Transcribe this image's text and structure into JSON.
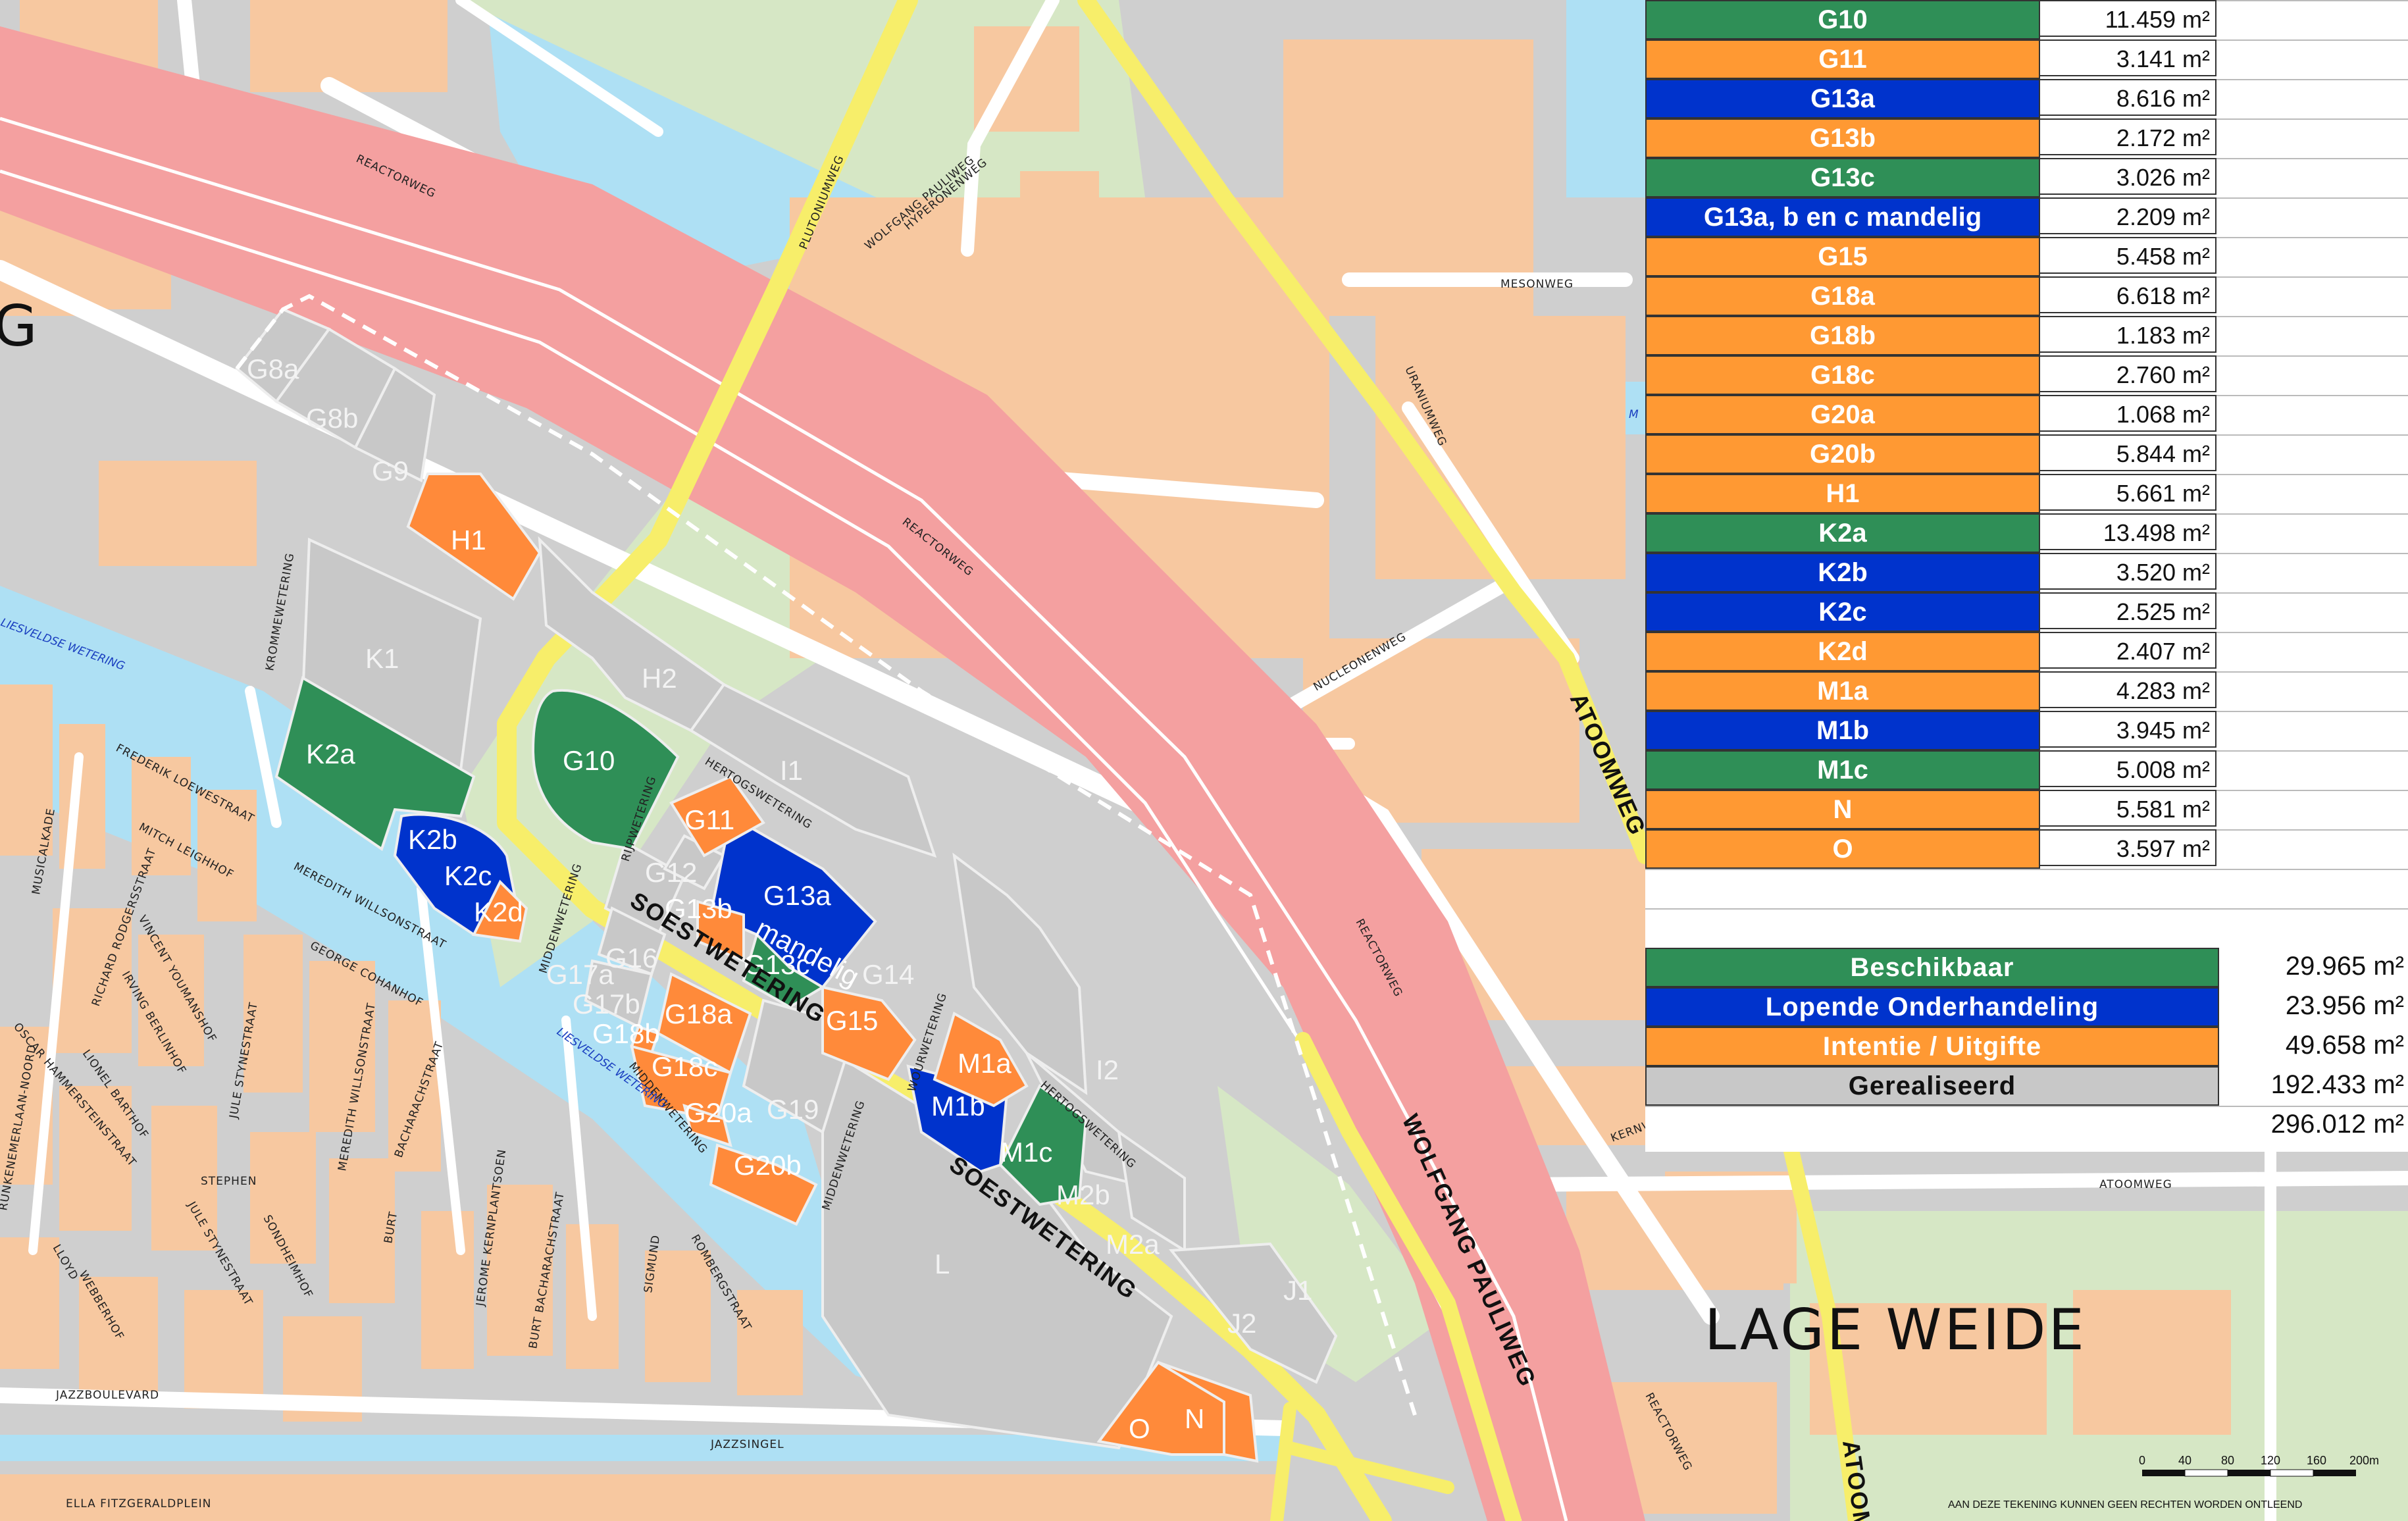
{
  "colors": {
    "beschikbaar": "#2f8f57",
    "onderhandeling": "#0033cc",
    "intentie": "#ff9933",
    "gerealiseerd": "#c8c8c8",
    "road": "#ffffff",
    "highway": "#f4a0a0",
    "main_road": "#f7ee6a",
    "building": "#f7c8a0",
    "water": "#aee0f4",
    "green": "#d6e7c5"
  },
  "map": {
    "area_label": "LAGE WEIDE",
    "partial_label": "G",
    "streets": {
      "reactorweg_1": "REACTORWEG",
      "reactorweg_2": "REACTORWEG",
      "reactorweg_3": "REACTORWEG",
      "reactorweg_4": "REACTORWEG",
      "plutoniumweg": "PLUTONIUMWEG",
      "wolfgang_pauliweg_1": "WOLFGANG PAULIWEG",
      "wolfgang_pauliweg_2": "WOLFGANG PAULIWEG",
      "hyperonenweg": "HYPERONENWEG",
      "mesonweg": "MESONWEG",
      "uraniumweg": "URANIUMWEG",
      "nucleonenweg": "NUCLEONENWEG",
      "atoomweg_1": "ATOOMWEG",
      "atoomweg_2": "ATOOMWEG",
      "atoomweg_3": "ATOOMWEG",
      "soestwetering_1": "SOESTWETERING",
      "soestwetering_2": "SOESTWETERING",
      "hertogswetering_1": "HERTOGSWETERING",
      "hertogswetering_2": "HERTOGSWETERING",
      "rijpwetering": "RIJPWETERING",
      "middenwetering_1": "MIDDENWETERING",
      "middenwetering_2": "MIDDENWETERING",
      "middenwetering_3": "MIDDENWETERING",
      "wourwetering": "WOURWETERING",
      "krommewetering": "KROMMEWETERING",
      "frederik_loewestraat": "FREDERIK LOEWESTRAAT",
      "mitch_leighhof": "MITCH LEIGHHOF",
      "musicalkade": "MUSICALKADE",
      "meredith_willsonstraat_1": "MEREDITH WILLSONSTRAAT",
      "meredith_willsonstraat_2": "MEREDITH WILLSONSTRAAT",
      "george_cohanhof": "GEORGE COHANHOF",
      "jule_stynestraat_1": "JULE STYNESTRAAT",
      "jule_stynestraat_2": "JULE STYNESTRAAT",
      "lionel_barthof": "LIONEL BARTHOF",
      "oscar_hammersteinstraat": "OSCAR HAMMERSTEINSTRAAT",
      "richard_rodgersstraat": "RICHARD RODGERSSTRAAT",
      "vincent_youmanshof": "VINCENT YOUMANSHOF",
      "irving_berlinhof": "IRVING BERLINHOF",
      "bacharachstraat": "BACHARACHSTRAAT",
      "burt_bacharachstraat": "BURT BACHARACHSTRAAT",
      "jerome_kernplantsoen": "JEROME KERNPLANTSOEN",
      "rombergstraat": "ROMBERGSTRAAT",
      "sigmund": "SIGMUND",
      "stephen": "STEPHEN",
      "sondheimhof": "SONDHEIMHOF",
      "lloyd": "LLOYD",
      "webberhof": "WEBBERHOF",
      "jazzboulevard": "JAZZBOULEVARD",
      "jazzsingel": "JAZZSINGEL",
      "ella_fitzgeraldplein": "ELLA FITZGERALDPLEIN",
      "runkenemerlaan_noord": "RUNKENEMERLAAN-NOORD",
      "kernweg": "KERNW",
      "burt": "BURT"
    },
    "water_labels": {
      "liesveldse_1": "LIESVELDSE WETERING",
      "liesveldse_2": "LIESVELDSE WETERING",
      "m": "M"
    }
  },
  "plots": {
    "G8a": "G8a",
    "G8b": "G8b",
    "G9": "G9",
    "H1": "H1",
    "H2": "H2",
    "K1": "K1",
    "K2a": "K2a",
    "K2b": "K2b",
    "K2c": "K2c",
    "K2d": "K2d",
    "G10": "G10",
    "I1": "I1",
    "G11": "G11",
    "G12": "G12",
    "G13a": "G13a",
    "mandelig": "mandelig",
    "G13b": "G13b",
    "G13c": "G13c",
    "G14": "G14",
    "G15": "G15",
    "G16": "G16",
    "G17a": "G17a",
    "G17b": "G17b",
    "G18a": "G18a",
    "G18b": "G18b",
    "G18c": "G18c",
    "G19": "G19",
    "G20a": "G20a",
    "G20b": "G20b",
    "M1a": "M1a",
    "M1b": "M1b",
    "M1c": "M1c",
    "I2": "I2",
    "M2a": "M2a",
    "M2b": "M2b",
    "L": "L",
    "J1": "J1",
    "J2": "J2",
    "O": "O",
    "N": "N"
  },
  "table": {
    "rows": [
      {
        "name": "G10",
        "area": "11.459 m²",
        "status": "beschikbaar"
      },
      {
        "name": "G11",
        "area": "3.141 m²",
        "status": "intentie"
      },
      {
        "name": "G13a",
        "area": "8.616 m²",
        "status": "onderhandeling"
      },
      {
        "name": "G13b",
        "area": "2.172 m²",
        "status": "intentie"
      },
      {
        "name": "G13c",
        "area": "3.026 m²",
        "status": "beschikbaar"
      },
      {
        "name": "G13a, b en c mandelig",
        "area": "2.209 m²",
        "status": "onderhandeling"
      },
      {
        "name": "G15",
        "area": "5.458 m²",
        "status": "intentie"
      },
      {
        "name": "G18a",
        "area": "6.618 m²",
        "status": "intentie"
      },
      {
        "name": "G18b",
        "area": "1.183 m²",
        "status": "intentie"
      },
      {
        "name": "G18c",
        "area": "2.760 m²",
        "status": "intentie"
      },
      {
        "name": "G20a",
        "area": "1.068 m²",
        "status": "intentie"
      },
      {
        "name": "G20b",
        "area": "5.844 m²",
        "status": "intentie"
      },
      {
        "name": "H1",
        "area": "5.661 m²",
        "status": "intentie"
      },
      {
        "name": "K2a",
        "area": "13.498 m²",
        "status": "beschikbaar"
      },
      {
        "name": "K2b",
        "area": "3.520 m²",
        "status": "onderhandeling"
      },
      {
        "name": "K2c",
        "area": "2.525 m²",
        "status": "onderhandeling"
      },
      {
        "name": "K2d",
        "area": "2.407 m²",
        "status": "intentie"
      },
      {
        "name": "M1a",
        "area": "4.283 m²",
        "status": "intentie"
      },
      {
        "name": "M1b",
        "area": "3.945 m²",
        "status": "onderhandeling"
      },
      {
        "name": "M1c",
        "area": "5.008 m²",
        "status": "beschikbaar"
      },
      {
        "name": "N",
        "area": "5.581 m²",
        "status": "intentie"
      },
      {
        "name": "O",
        "area": "3.597 m²",
        "status": "intentie"
      }
    ],
    "summary": [
      {
        "label": "Beschikbaar",
        "area": "29.965 m²",
        "status": "beschikbaar"
      },
      {
        "label": "Lopende Onderhandeling",
        "area": "23.956 m²",
        "status": "onderhandeling"
      },
      {
        "label": "Intentie / Uitgifte",
        "area": "49.658 m²",
        "status": "intentie"
      },
      {
        "label": "Gerealiseerd",
        "area": "192.433 m²",
        "status": "gerealiseerd"
      }
    ],
    "total": "296.012 m²"
  },
  "scale": {
    "ticks": [
      "0",
      "40",
      "80",
      "120",
      "160",
      "200m"
    ]
  },
  "disclaimer": "AAN DEZE TEKENING KUNNEN GEEN RECHTEN WORDEN ONTLEEND"
}
